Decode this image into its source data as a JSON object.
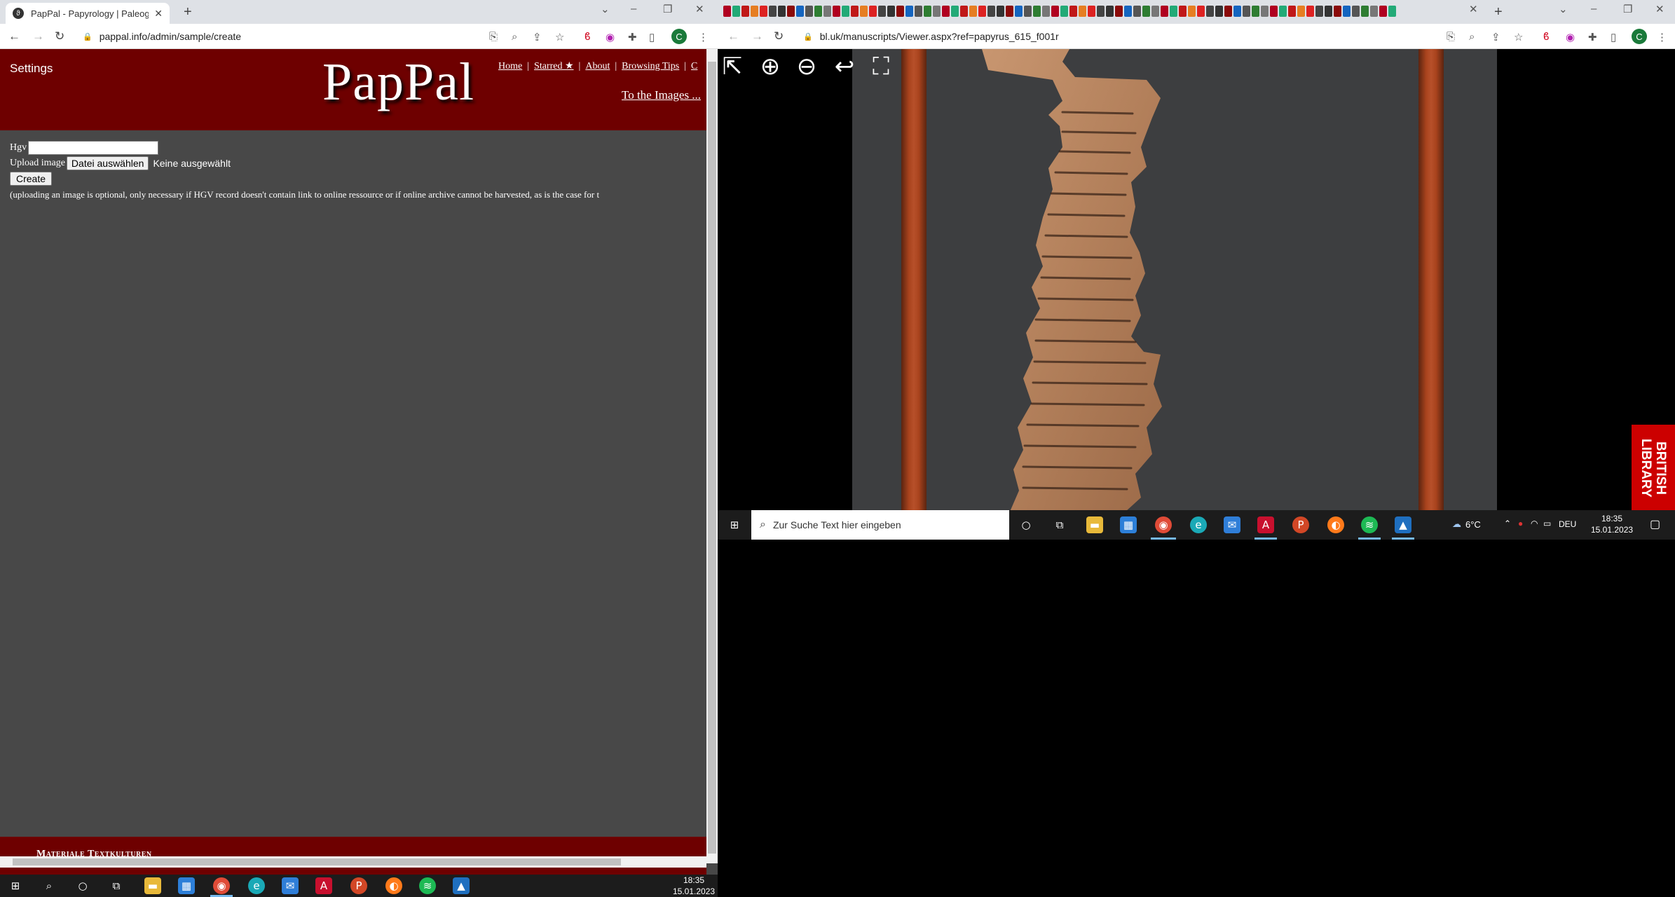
{
  "left_browser": {
    "tab_title": "PapPal - Papyrology | Paleograph",
    "url": "pappal.info/admin/sample/create"
  },
  "pappal": {
    "settings": "Settings",
    "logo": "PapPal",
    "nav": [
      "Home",
      "Starred ★",
      "About",
      "Browsing Tips",
      "C"
    ],
    "to_images": "To the Images ...",
    "form": {
      "hgv_label": "Hgv",
      "hgv_value": "",
      "upload_label": "Upload image",
      "file_button": "Datei auswählen",
      "no_file": "Keine ausgewählt",
      "create_button": "Create",
      "note": "(uploading an image is optional, only necessary if HGV record doesn't contain link to online ressource or if online archive cannot be harvested, as is the case for t"
    },
    "footer": "Materiale Textkulturen"
  },
  "right_browser": {
    "url": "bl.uk/manuscripts/Viewer.aspx?ref=papyrus_615_f001r",
    "badge": "BRITISH LIBRARY"
  },
  "taskbar_left": {
    "time": "18:35",
    "date": "15.01.2023"
  },
  "taskbar_right": {
    "search_placeholder": "Zur Suche Text hier eingeben",
    "weather": "6°C",
    "lang": "DEU",
    "time": "18:35",
    "date": "15.01.2023"
  },
  "colors": {
    "pappal_red": "#6e0000",
    "page_bg": "#484848",
    "bl_red": "#cc0000"
  }
}
